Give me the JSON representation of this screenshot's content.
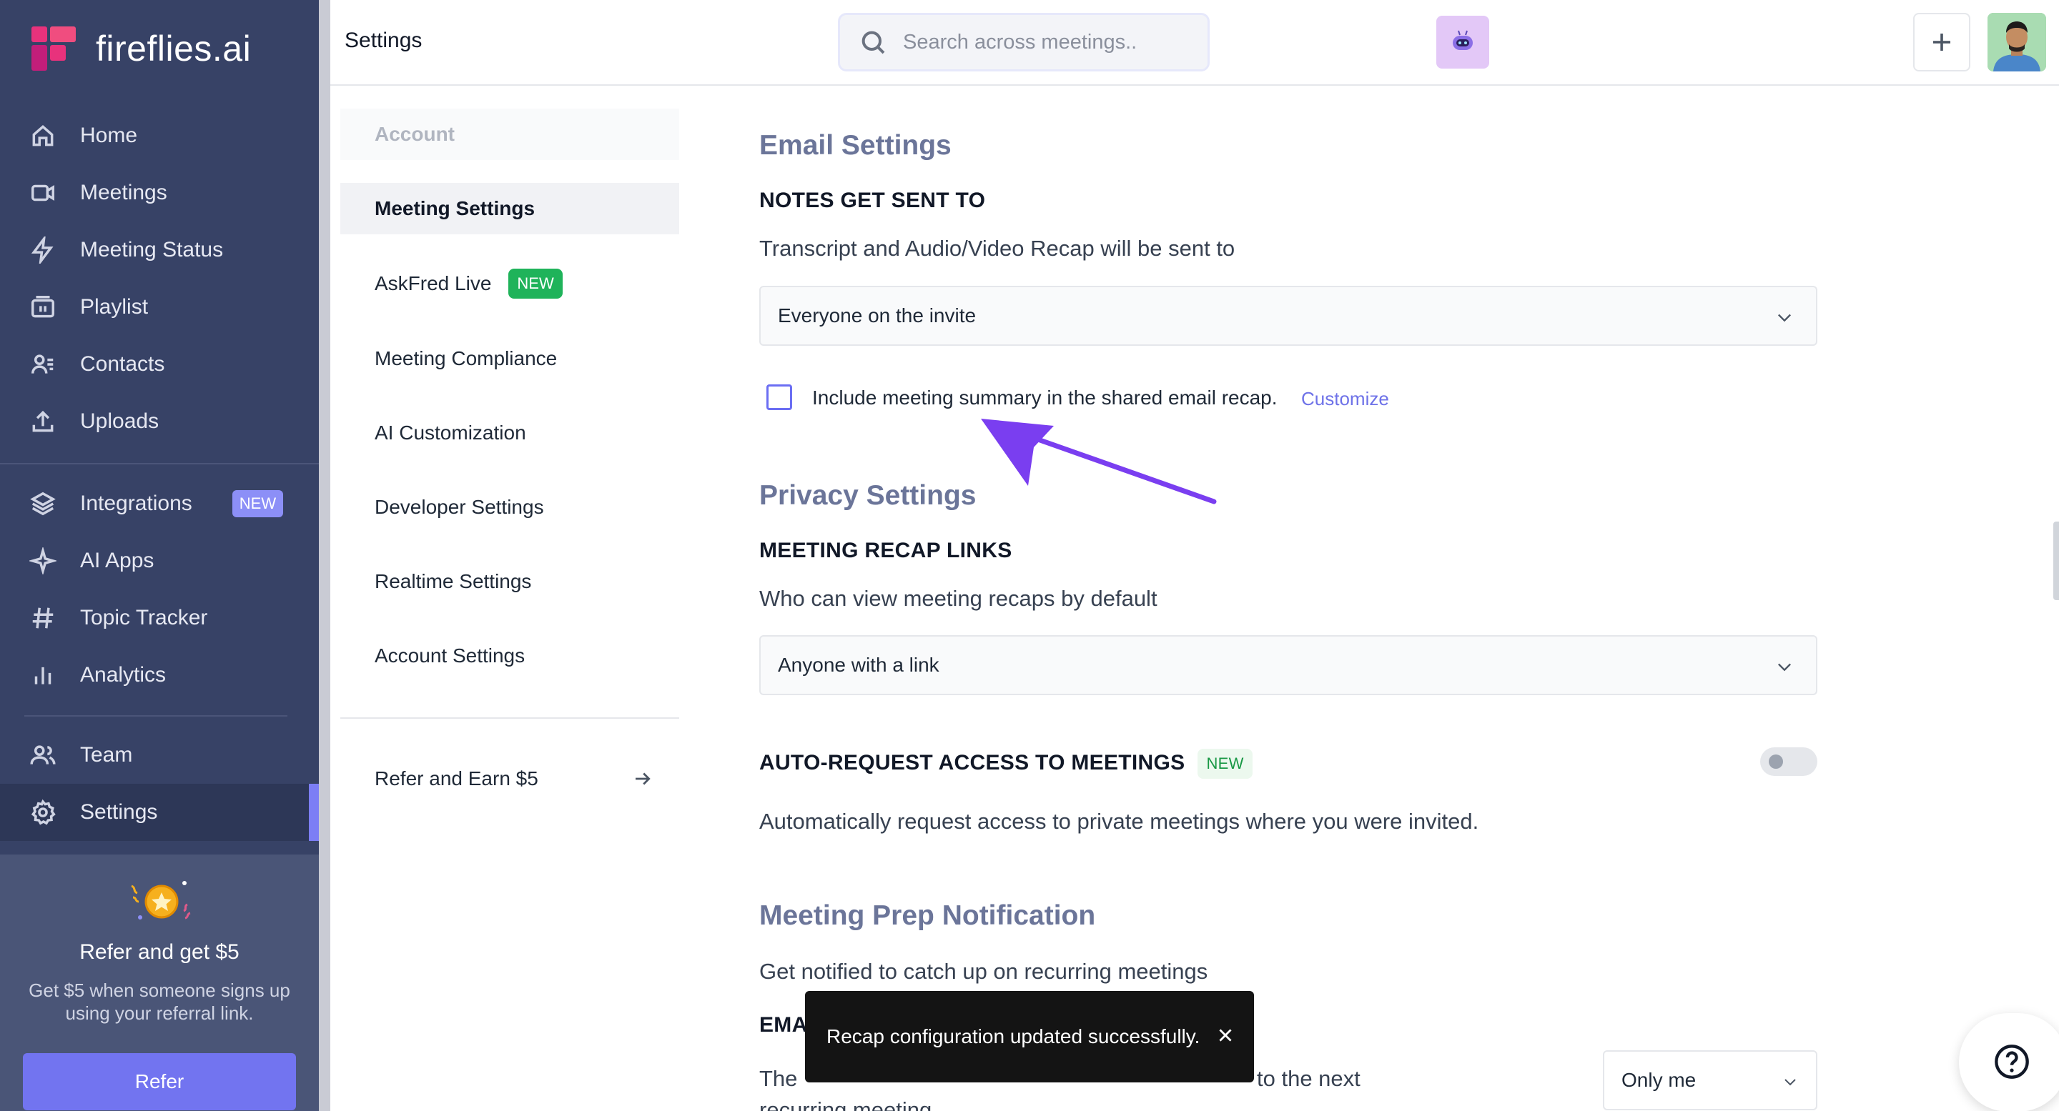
{
  "brand": {
    "name": "fireflies.ai",
    "accent": "#7c7ef5",
    "sidebar_bg": "#374266"
  },
  "sidebar": {
    "items": [
      {
        "label": "Home",
        "icon": "home-icon"
      },
      {
        "label": "Meetings",
        "icon": "video-icon"
      },
      {
        "label": "Meeting Status",
        "icon": "lightning-icon"
      },
      {
        "label": "Playlist",
        "icon": "playlist-icon"
      },
      {
        "label": "Contacts",
        "icon": "contacts-icon"
      },
      {
        "label": "Uploads",
        "icon": "upload-icon"
      },
      {
        "label": "Integrations",
        "icon": "layers-icon",
        "badge": "NEW"
      },
      {
        "label": "AI Apps",
        "icon": "sparkle-icon"
      },
      {
        "label": "Topic Tracker",
        "icon": "hash-icon"
      },
      {
        "label": "Analytics",
        "icon": "analytics-icon"
      },
      {
        "label": "Team",
        "icon": "team-icon"
      },
      {
        "label": "Settings",
        "icon": "gear-icon",
        "active": true
      }
    ],
    "refer": {
      "title": "Refer and get $5",
      "description": "Get $5 when someone signs up using your referral link.",
      "button": "Refer"
    }
  },
  "header": {
    "title": "Settings",
    "search_placeholder": "Search across meetings.."
  },
  "submenu": {
    "section": "Account",
    "items": [
      {
        "label": "Meeting Settings",
        "active": true
      },
      {
        "label": "AskFred Live",
        "badge": "NEW"
      },
      {
        "label": "Meeting Compliance"
      },
      {
        "label": "AI Customization"
      },
      {
        "label": "Developer Settings"
      },
      {
        "label": "Realtime Settings"
      },
      {
        "label": "Account Settings"
      }
    ],
    "refer_link": "Refer and Earn $5"
  },
  "main": {
    "email": {
      "heading": "Email Settings",
      "sub": "NOTES GET SENT TO",
      "desc": "Transcript and Audio/Video Recap will be sent to",
      "select_value": "Everyone on the invite",
      "checkbox_label": "Include meeting summary in the shared email recap.",
      "checkbox_checked": false,
      "customize": "Customize"
    },
    "privacy": {
      "heading": "Privacy Settings",
      "sub": "MEETING RECAP LINKS",
      "desc": "Who can view meeting recaps by default",
      "select_value": "Anyone with a link",
      "auto_title": "AUTO-REQUEST ACCESS TO MEETINGS",
      "auto_badge": "NEW",
      "auto_desc": "Automatically request access to private meetings where you were invited.",
      "auto_enabled": false
    },
    "prep": {
      "heading": "Meeting Prep Notification",
      "desc": "Get notified to catch up on recurring meetings",
      "email_label_visible": "EMA",
      "email_desc_start": "The",
      "email_desc_end": "to the next",
      "email_desc_line2": "recurring meeting",
      "select_value": "Only me"
    }
  },
  "toast": {
    "message": "Recap configuration updated successfully."
  }
}
